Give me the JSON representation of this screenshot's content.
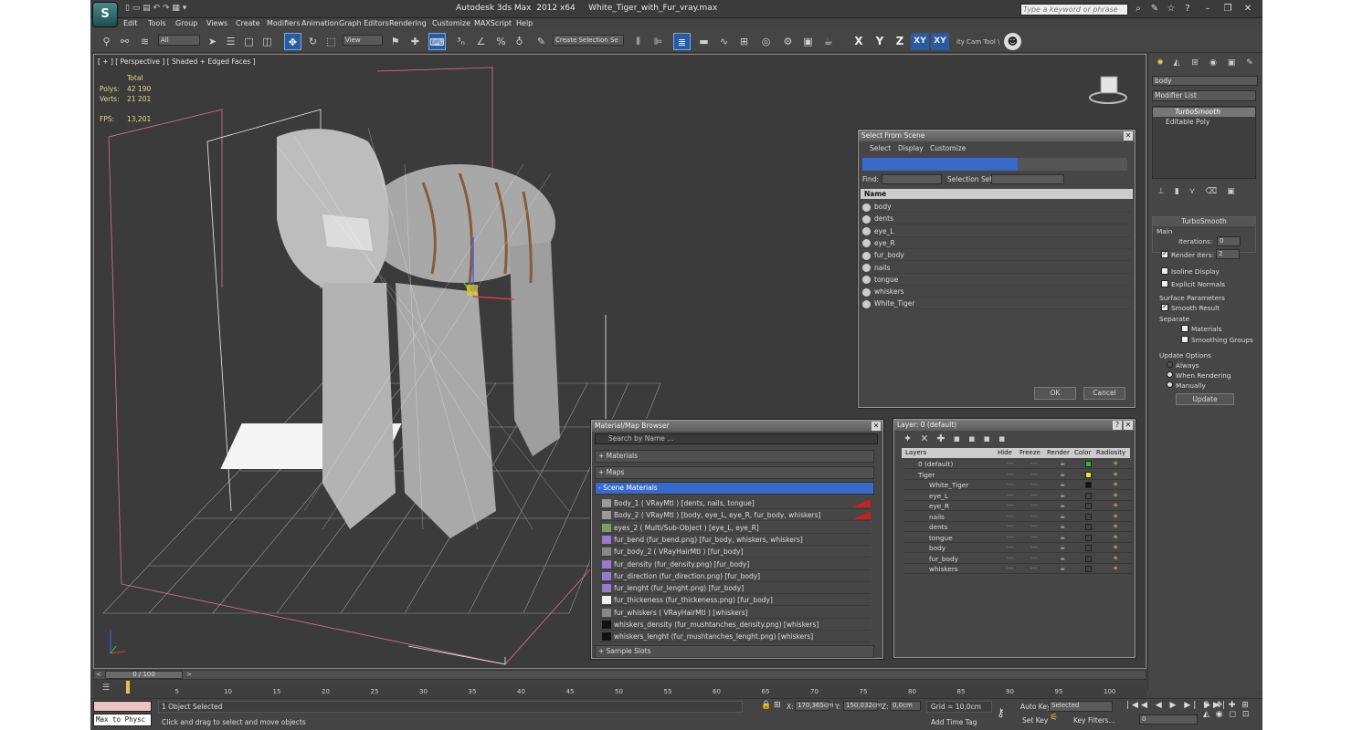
{
  "window": {
    "title": "Autodesk 3ds Max  2012 x64     White_Tiger_with_Fur_vray.max",
    "search_placeholder": "Type a keyword or phrase",
    "logo": "S"
  },
  "menu": [
    "Edit",
    "Tools",
    "Group",
    "Views",
    "Create",
    "Modifiers",
    "Animation",
    "Graph Editors",
    "Rendering",
    "Customize",
    "MAXScript",
    "Help"
  ],
  "toolbar": {
    "selection_filter": "All",
    "ref_coord": "View",
    "selection_set": "Create Selection Se",
    "axis": [
      "X",
      "Y",
      "Z",
      "XY",
      "XY"
    ],
    "cam_tool": "ity Cam Tool \\"
  },
  "viewport": {
    "label": "[ + ] [ Perspective ] [ Shaded + Edged Faces ]",
    "stats": {
      "total": "Total",
      "polys_label": "Polys:",
      "polys": "42 190",
      "verts_label": "Verts:",
      "verts": "21 201",
      "fps_label": "FPS:",
      "fps": "13,201"
    }
  },
  "select_from_scene": {
    "title": "Select From Scene",
    "menus": [
      "Select",
      "Display",
      "Customize"
    ],
    "find_label": "Find:",
    "selset_label": "Selection Set:",
    "column": "Name",
    "items": [
      "body",
      "dents",
      "eye_L",
      "eye_R",
      "fur_body",
      "nails",
      "tongue",
      "whiskers",
      "White_Tiger"
    ],
    "ok": "OK",
    "cancel": "Cancel"
  },
  "material_browser": {
    "title": "Material/Map Browser",
    "search": "Search by Name ...",
    "categories": [
      "+ Materials",
      "+ Maps",
      "- Scene Materials",
      "+ Sample Slots"
    ],
    "materials": [
      {
        "name": "Body_1  ( VRayMtl ) [dents, nails, tongue]",
        "color": "#9a9a9a"
      },
      {
        "name": "Body_2  ( VRayMtl ) [body, eye_L, eye_R, fur_body, whiskers]",
        "color": "#9a9a9a"
      },
      {
        "name": "eyes_2  ( Multi/Sub-Object ) [eye_L, eye_R]",
        "color": "#7c9c6c"
      },
      {
        "name": "fur_bend (fur_bend.png) [fur_body, whiskers, whiskers]",
        "color": "#9a7acc"
      },
      {
        "name": "fur_body_2  ( VRayHairMtl ) [fur_body]",
        "color": "#888"
      },
      {
        "name": "fur_density (fur_density.png) [fur_body]",
        "color": "#9a7acc"
      },
      {
        "name": "fur_direction (fur_direction.png) [fur_body]",
        "color": "#9a7acc"
      },
      {
        "name": "fur_lenght (fur_lenght.png) [fur_body]",
        "color": "#9a7acc"
      },
      {
        "name": "fur_thickeness (fur_thickeness.png) [fur_body]",
        "color": "#eeeeee"
      },
      {
        "name": "fur_whiskers  ( VRayHairMtl ) [whiskers]",
        "color": "#888"
      },
      {
        "name": "whiskers_density (fur_mushtanches_density.png) [whiskers]",
        "color": "#111111"
      },
      {
        "name": "whiskers_lenght (fur_mushtanches_lenght.png) [whiskers]",
        "color": "#111111"
      }
    ]
  },
  "layer_manager": {
    "title": "Layer: 0 (default)",
    "columns": [
      "Layers",
      "Hide",
      "Freeze",
      "Render",
      "Color",
      "Radiosity"
    ],
    "rows": [
      {
        "name": "0 (default)",
        "indent": 1,
        "color": "#3ab03a"
      },
      {
        "name": "Tiger",
        "indent": 1,
        "color": "#e8e83a"
      },
      {
        "name": "White_Tiger",
        "indent": 2,
        "color": "#111111"
      },
      {
        "name": "eye_L",
        "indent": 2,
        "color": "#444444"
      },
      {
        "name": "eye_R",
        "indent": 2,
        "color": "#444444"
      },
      {
        "name": "nails",
        "indent": 2,
        "color": "#444444"
      },
      {
        "name": "dents",
        "indent": 2,
        "color": "#444444"
      },
      {
        "name": "tongue",
        "indent": 2,
        "color": "#444444"
      },
      {
        "name": "body",
        "indent": 2,
        "color": "#444444"
      },
      {
        "name": "fur_body",
        "indent": 2,
        "color": "#444444"
      },
      {
        "name": "whiskers",
        "indent": 2,
        "color": "#444444"
      }
    ]
  },
  "command_panel": {
    "object_name": "body",
    "modifier_list": "Modifier List",
    "stack": [
      "TurboSmooth",
      "Editable Poly"
    ],
    "rollout_title": "TurboSmooth",
    "main": "Main",
    "iterations_label": "Iterations:",
    "iterations": "0",
    "render_iters_label": "Render Iters:",
    "render_iters": "2",
    "isoline": "Isoline Display",
    "explicit": "Explicit Normals",
    "surface_params": "Surface Parameters",
    "smooth_result": "Smooth Result",
    "separate": "Separate",
    "materials": "Materials",
    "smoothing_groups": "Smoothing Groups",
    "update_options": "Update Options",
    "always": "Always",
    "when_rendering": "When Rendering",
    "manually": "Manually",
    "update": "Update"
  },
  "timeline": {
    "range": "0 / 100",
    "ticks": [
      "0",
      "5",
      "10",
      "15",
      "20",
      "25",
      "30",
      "35",
      "40",
      "45",
      "50",
      "55",
      "60",
      "65",
      "70",
      "75",
      "80",
      "85",
      "90",
      "95",
      "100"
    ]
  },
  "status": {
    "script_btn": "Max to Physc",
    "selected": "1 Object Selected",
    "prompt": "Click and drag to select and move objects",
    "x_label": "X:",
    "x": "170,365cm",
    "y_label": "Y:",
    "y": "150,032cm",
    "z_label": "Z:",
    "z": "0,0cm",
    "grid": "Grid = 10,0cm",
    "add_time_tag": "Add Time Tag",
    "auto_key": "Auto Key",
    "set_key": "Set Key",
    "selected_mode": "Selected",
    "key_filters": "Key Filters...",
    "frame": "0"
  }
}
